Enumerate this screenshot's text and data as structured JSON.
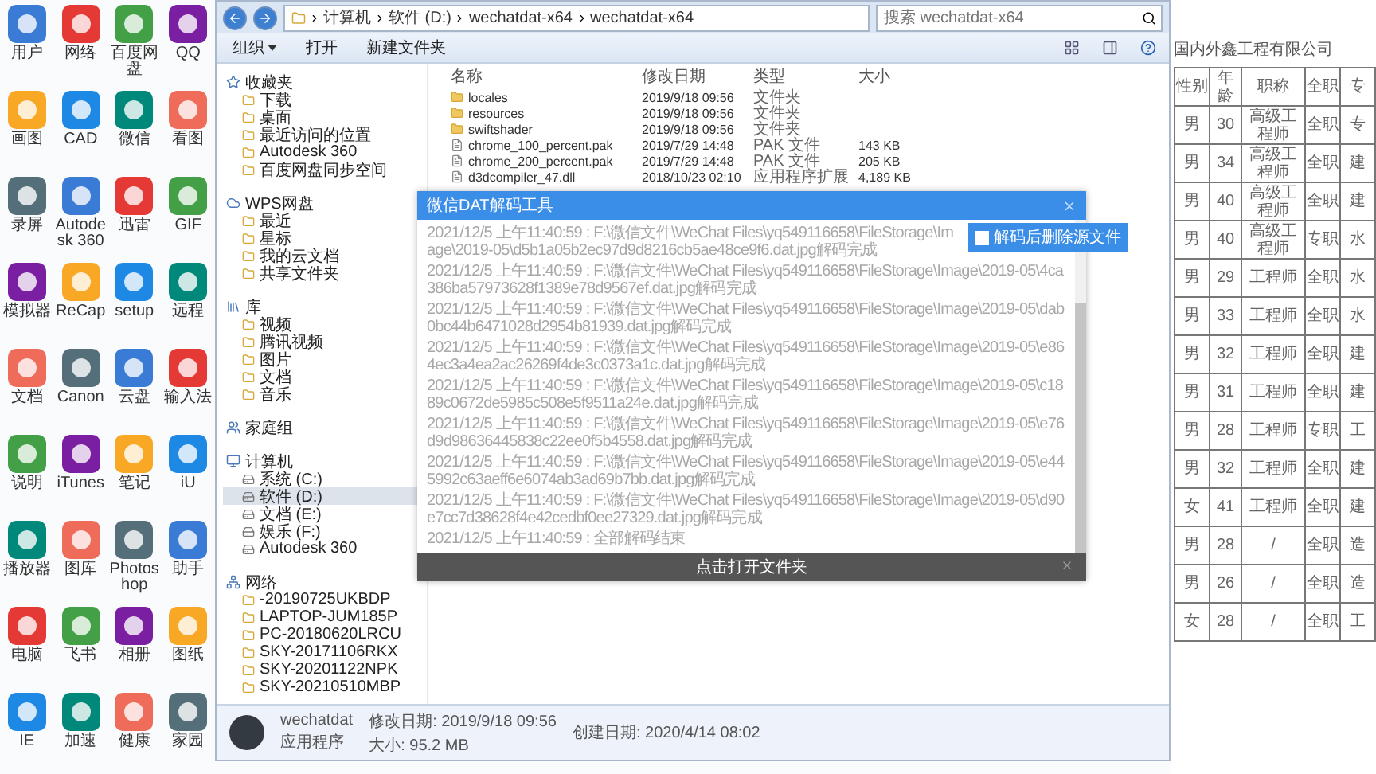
{
  "desktop_icons": [
    {
      "label": "用户"
    },
    {
      "label": "网络"
    },
    {
      "label": "百度网盘"
    },
    {
      "label": "QQ"
    },
    {
      "label": "画图"
    },
    {
      "label": "CAD"
    },
    {
      "label": "微信"
    },
    {
      "label": "看图"
    },
    {
      "label": "录屏"
    },
    {
      "label": "Autodesk 360"
    },
    {
      "label": "迅雷"
    },
    {
      "label": "GIF"
    },
    {
      "label": "模拟器"
    },
    {
      "label": "ReCap"
    },
    {
      "label": "setup"
    },
    {
      "label": "远程"
    },
    {
      "label": "文档"
    },
    {
      "label": "Canon"
    },
    {
      "label": "云盘"
    },
    {
      "label": "输入法"
    },
    {
      "label": "说明"
    },
    {
      "label": "iTunes"
    },
    {
      "label": "笔记"
    },
    {
      "label": "iU"
    },
    {
      "label": "播放器"
    },
    {
      "label": "图库"
    },
    {
      "label": "Photoshop"
    },
    {
      "label": "助手"
    },
    {
      "label": "电脑"
    },
    {
      "label": "飞书"
    },
    {
      "label": "相册"
    },
    {
      "label": "图纸"
    },
    {
      "label": "IE"
    },
    {
      "label": "加速"
    },
    {
      "label": "健康"
    },
    {
      "label": "家园"
    }
  ],
  "explorer": {
    "breadcrumb": [
      "计算机",
      "软件 (D:)",
      "wechatdat-x64",
      "wechatdat-x64"
    ],
    "search": {
      "placeholder": "搜索 wechatdat-x64"
    },
    "toolbar": [
      {
        "label": "组织",
        "kind": "menu"
      },
      {
        "label": "打开",
        "kind": "action"
      },
      {
        "label": "新建文件夹",
        "kind": "action"
      }
    ],
    "sidebar": [
      {
        "label": "收藏夹",
        "selected": false,
        "children": [
          {
            "label": "下载",
            "selected": false
          },
          {
            "label": "桌面",
            "selected": false
          },
          {
            "label": "最近访问的位置",
            "selected": false
          },
          {
            "label": "Autodesk 360",
            "selected": false
          },
          {
            "label": "百度网盘同步空间",
            "selected": false
          }
        ]
      },
      {
        "label": "WPS网盘",
        "selected": false,
        "children": [
          {
            "label": "最近",
            "selected": false
          },
          {
            "label": "星标",
            "selected": false
          },
          {
            "label": "我的云文档",
            "selected": false
          },
          {
            "label": "共享文件夹",
            "selected": false
          }
        ]
      },
      {
        "label": "库",
        "selected": false,
        "children": [
          {
            "label": "视频",
            "selected": false
          },
          {
            "label": "腾讯视频",
            "selected": false
          },
          {
            "label": "图片",
            "selected": false
          },
          {
            "label": "文档",
            "selected": false
          },
          {
            "label": "音乐",
            "selected": false
          }
        ]
      },
      {
        "label": "家庭组",
        "selected": false
      },
      {
        "label": "计算机",
        "selected": false,
        "children": [
          {
            "label": "系统 (C:)",
            "selected": false
          },
          {
            "label": "软件 (D:)",
            "selected": true
          },
          {
            "label": "文档 (E:)",
            "selected": false
          },
          {
            "label": "娱乐 (F:)",
            "selected": false
          },
          {
            "label": "Autodesk 360",
            "selected": false
          }
        ]
      },
      {
        "label": "网络",
        "selected": false,
        "children": [
          {
            "label": "-20190725UKBDP",
            "selected": false
          },
          {
            "label": "LAPTOP-JUM185P",
            "selected": false
          },
          {
            "label": "PC-20180620LRCU",
            "selected": false
          },
          {
            "label": "SKY-20171106RKX",
            "selected": false
          },
          {
            "label": "SKY-20201122NPK",
            "selected": false
          },
          {
            "label": "SKY-20210510MBP",
            "selected": false
          }
        ]
      }
    ],
    "columns": [
      "名称",
      "修改日期",
      "类型",
      "大小"
    ],
    "files": [
      {
        "kind": "folder",
        "name": "locales",
        "modified": "2019/9/18 09:56",
        "type": "文件夹"
      },
      {
        "kind": "folder",
        "name": "resources",
        "modified": "2019/9/18 09:56",
        "type": "文件夹"
      },
      {
        "kind": "folder",
        "name": "swiftshader",
        "modified": "2019/9/18 09:56",
        "type": "文件夹"
      },
      {
        "kind": "file",
        "name": "chrome_100_percent.pak",
        "modified": "2019/7/29 14:48",
        "type": "PAK 文件",
        "size": "143 KB"
      },
      {
        "kind": "file",
        "name": "chrome_200_percent.pak",
        "modified": "2019/7/29 14:48",
        "type": "PAK 文件",
        "size": "205 KB"
      },
      {
        "kind": "dll",
        "name": "d3dcompiler_47.dll",
        "modified": "2018/10/23 02:10",
        "type": "应用程序扩展",
        "size": "4,189 KB"
      }
    ],
    "status": {
      "name": "wechatdat",
      "kind_label": "应用程序",
      "modified": "修改日期: 2019/9/18 09:56",
      "size": "大小: 95.2 MB",
      "created": "创建日期: 2020/4/14 08:02"
    }
  },
  "dialog": {
    "title": "微信DAT解码工具",
    "option": {
      "label": "解码后删除源文件",
      "checked": false
    },
    "log": [
      "2021/12/5 上午11:40:59 : F:\\微信文件\\WeChat Files\\yq549116658\\FileStorage\\Image\\2019-05\\d5b1a05b2ec97d9d8216cb5ae48ce9f6.dat.jpg解码完成",
      "2021/12/5 上午11:40:59 : F:\\微信文件\\WeChat Files\\yq549116658\\FileStorage\\Image\\2019-05\\4ca386ba57973628f1389e78d9567ef.dat.jpg解码完成",
      "2021/12/5 上午11:40:59 : F:\\微信文件\\WeChat Files\\yq549116658\\FileStorage\\Image\\2019-05\\dab0bc44b6471028d2954b81939.dat.jpg解码完成",
      "2021/12/5 上午11:40:59 : F:\\微信文件\\WeChat Files\\yq549116658\\FileStorage\\Image\\2019-05\\e864ec3a4ea2ac26269f4de3c0373a1c.dat.jpg解码完成",
      "2021/12/5 上午11:40:59 : F:\\微信文件\\WeChat Files\\yq549116658\\FileStorage\\Image\\2019-05\\c1889c0672de5985c508e5f9511a24e.dat.jpg解码完成",
      "2021/12/5 上午11:40:59 : F:\\微信文件\\WeChat Files\\yq549116658\\FileStorage\\Image\\2019-05\\e76d9d98636445838c22ee0f5b4558.dat.jpg解码完成",
      "2021/12/5 上午11:40:59 : F:\\微信文件\\WeChat Files\\yq549116658\\FileStorage\\Image\\2019-05\\e445992c63aeff6e6074ab3ad69b7bb.dat.jpg解码完成",
      "2021/12/5 上午11:40:59 : F:\\微信文件\\WeChat Files\\yq549116658\\FileStorage\\Image\\2019-05\\d90e7cc7d38628f4e42cedbf0ee27329.dat.jpg解码完成",
      "2021/12/5 上午11:40:59 : 全部解码结束"
    ],
    "footer_button": "点击打开文件夹"
  },
  "sheet": {
    "title": "国内外鑫工程有限公司",
    "columns": [
      "性别",
      "年龄",
      "职称",
      "全职",
      "专"
    ],
    "rows": [
      [
        "男",
        "30",
        "高级工程师",
        "全职",
        "专"
      ],
      [
        "男",
        "34",
        "高级工程师",
        "全职",
        "建"
      ],
      [
        "男",
        "40",
        "高级工程师",
        "全职",
        "建"
      ],
      [
        "男",
        "40",
        "高级工程师",
        "专职",
        "水"
      ],
      [
        "男",
        "29",
        "工程师",
        "全职",
        "水"
      ],
      [
        "男",
        "33",
        "工程师",
        "全职",
        "水"
      ],
      [
        "男",
        "32",
        "工程师",
        "全职",
        "建"
      ],
      [
        "男",
        "31",
        "工程师",
        "全职",
        "建"
      ],
      [
        "男",
        "28",
        "工程师",
        "专职",
        "工"
      ],
      [
        "男",
        "32",
        "工程师",
        "全职",
        "建"
      ],
      [
        "女",
        "41",
        "工程师",
        "全职",
        "建"
      ],
      [
        "男",
        "28",
        "/",
        "全职",
        "造"
      ],
      [
        "男",
        "26",
        "/",
        "全职",
        "造"
      ],
      [
        "女",
        "28",
        "/",
        "全职",
        "工"
      ]
    ]
  }
}
